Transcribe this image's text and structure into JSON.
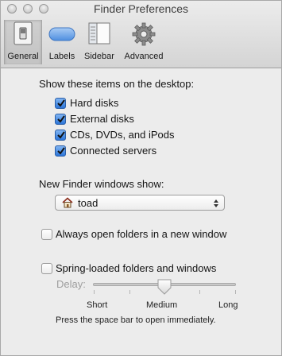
{
  "window": {
    "title": "Finder Preferences"
  },
  "toolbar": {
    "tabs": [
      {
        "label": "General",
        "icon": "general-switch-icon",
        "selected": true
      },
      {
        "label": "Labels",
        "icon": "labels-pill-icon",
        "selected": false
      },
      {
        "label": "Sidebar",
        "icon": "sidebar-icon",
        "selected": false
      },
      {
        "label": "Advanced",
        "icon": "gear-icon",
        "selected": false
      }
    ]
  },
  "desktop": {
    "heading": "Show these items on the desktop:",
    "items": [
      {
        "label": "Hard disks",
        "checked": true
      },
      {
        "label": "External disks",
        "checked": true
      },
      {
        "label": "CDs, DVDs, and iPods",
        "checked": true
      },
      {
        "label": "Connected servers",
        "checked": true
      }
    ]
  },
  "new_window": {
    "label": "New Finder windows show:",
    "selected": "toad",
    "icon": "home-icon"
  },
  "always_open": {
    "label": "Always open folders in a new window",
    "checked": false
  },
  "spring_loaded": {
    "label": "Spring-loaded folders and windows",
    "checked": false,
    "delay_label": "Delay:",
    "delay_level": "Medium",
    "slider_value": 0.5,
    "ticks": {
      "short": "Short",
      "medium": "Medium",
      "long": "Long"
    },
    "hint": "Press the space bar to open immediately."
  },
  "colors": {
    "accent": "#2c75d8",
    "window_bg": "#ececec"
  }
}
